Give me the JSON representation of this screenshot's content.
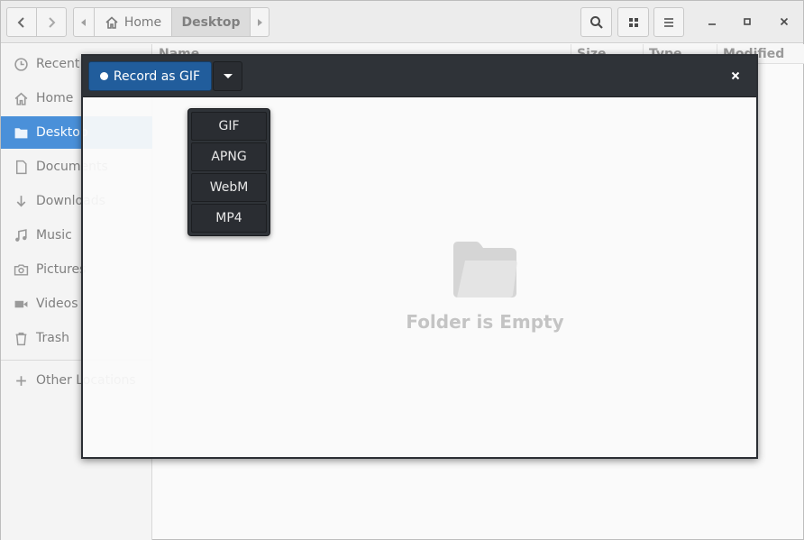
{
  "pathbar": {
    "home_label": "Home",
    "current_label": "Desktop"
  },
  "sidebar": {
    "items": [
      {
        "label": "Recent",
        "icon": "clock-icon"
      },
      {
        "label": "Home",
        "icon": "home-icon"
      },
      {
        "label": "Desktop",
        "icon": "folder-icon"
      },
      {
        "label": "Documents",
        "icon": "document-icon"
      },
      {
        "label": "Downloads",
        "icon": "download-icon"
      },
      {
        "label": "Music",
        "icon": "music-icon"
      },
      {
        "label": "Pictures",
        "icon": "camera-icon"
      },
      {
        "label": "Videos",
        "icon": "video-icon"
      },
      {
        "label": "Trash",
        "icon": "trash-icon"
      }
    ],
    "other_locations": "Other Locations"
  },
  "columns": {
    "name": "Name",
    "size": "Size",
    "type": "Type",
    "modified": "Modified"
  },
  "recorder": {
    "record_label": "Record as GIF",
    "formats": [
      "GIF",
      "APNG",
      "WebM",
      "MP4"
    ],
    "selected_format": "GIF"
  },
  "empty_state": {
    "text": "Folder is Empty"
  },
  "colors": {
    "accent": "#4a90d9",
    "record_button": "#215d9c",
    "toolbar_dark": "#2f3338"
  }
}
